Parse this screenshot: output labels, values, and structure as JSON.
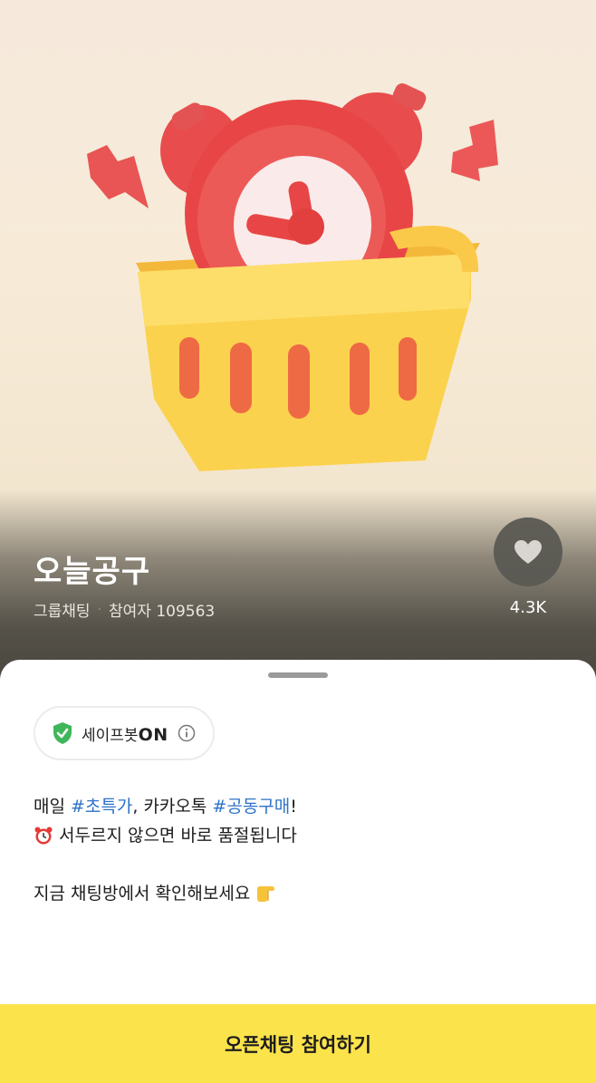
{
  "room": {
    "title": "오늘공구",
    "type": "그룹채팅",
    "separator": "·",
    "participants": "참여자 109563",
    "likes": "4.3K"
  },
  "safebot": {
    "label": "세이프봇",
    "status": "ON"
  },
  "description": {
    "line1_prefix": "매일 ",
    "line1_tag1": "#초특가",
    "line1_mid": ", 카카오톡 ",
    "line1_tag2": "#공동구매",
    "line1_suffix": "!",
    "line2": "서두르지 않으면 바로 품절됩니다",
    "line3": "지금 채팅방에서 확인해보세요"
  },
  "cta": {
    "label": "오픈채팅 참여하기"
  },
  "icons": {
    "hero": "alarm-clock-in-basket-illustration",
    "like": "heart-icon",
    "safebot": "shield-check-icon",
    "info": "info-icon",
    "clock_emoji": "alarm-clock-icon",
    "point_emoji": "pointing-hand-icon"
  },
  "colors": {
    "accent_yellow": "#fbe34b",
    "tag_blue": "#2e72c8",
    "shield_green": "#3fb65a"
  }
}
